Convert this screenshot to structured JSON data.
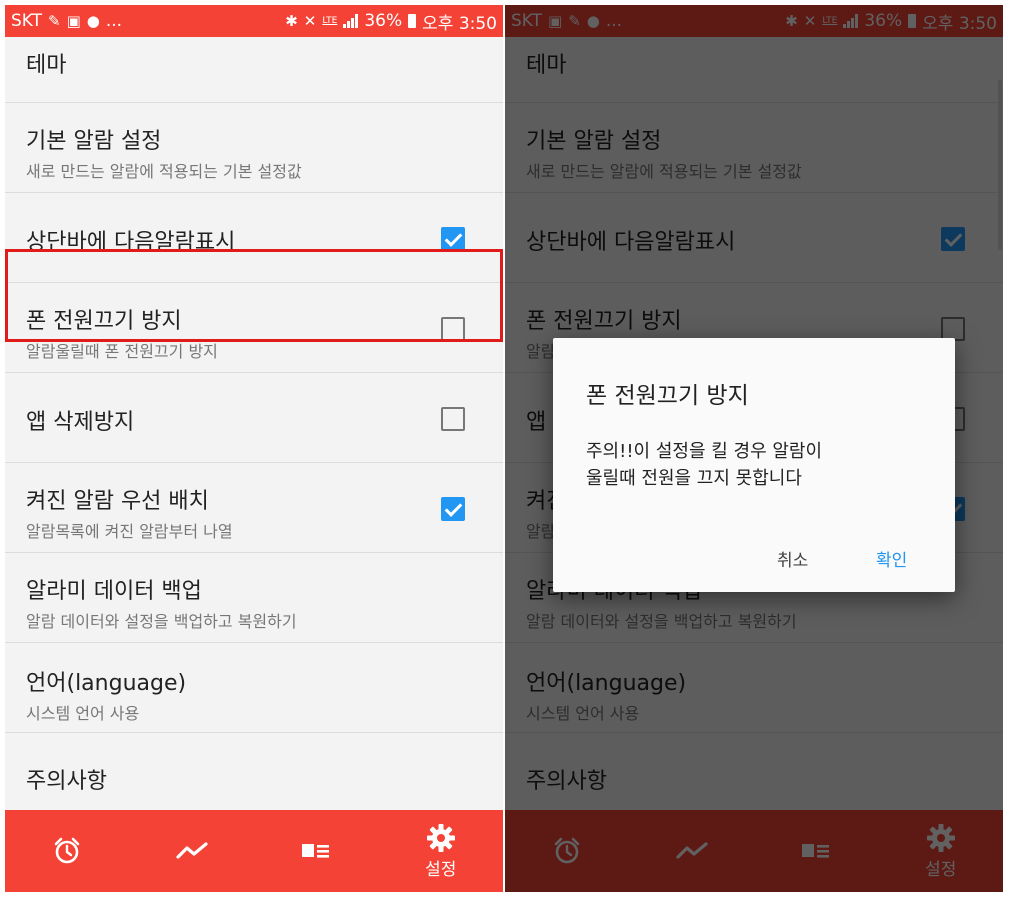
{
  "status_bar": {
    "carrier": "SKT",
    "dots": "...",
    "lte": "LTE",
    "battery": "36%",
    "time": "오후 3:50"
  },
  "settings": {
    "rows": [
      {
        "title": "테마",
        "subtitle": ""
      },
      {
        "title": "기본 알람 설정",
        "subtitle": "새로 만드는 알람에 적용되는 기본 설정값"
      },
      {
        "title": "상단바에 다음알람표시",
        "subtitle": "",
        "checked": true
      },
      {
        "title": "폰 전원끄기 방지",
        "subtitle": "알람울릴때 폰 전원끄기 방지",
        "checked": false
      },
      {
        "title": "앱 삭제방지",
        "subtitle": "",
        "checked": false
      },
      {
        "title": "켜진 알람 우선 배치",
        "subtitle": "알람목록에 켜진 알람부터 나열",
        "checked": true
      },
      {
        "title": "알라미 데이터 백업",
        "subtitle": "알람 데이터와 설정을 백업하고 복원하기"
      },
      {
        "title": "언어(language)",
        "subtitle": "시스템 언어 사용"
      },
      {
        "title": "주의사항",
        "subtitle": ""
      }
    ]
  },
  "bottom_nav": {
    "items": [
      {
        "icon": "alarm-clock-icon",
        "label": ""
      },
      {
        "icon": "trend-chart-icon",
        "label": ""
      },
      {
        "icon": "list-card-icon",
        "label": ""
      },
      {
        "icon": "gear-icon",
        "label": "설정"
      }
    ]
  },
  "dialog": {
    "title": "폰 전원끄기 방지",
    "message": "주의!!이 설정을 킬 경우 알람이\n울릴때 전원을 끄지 못합니다",
    "cancel_label": "취소",
    "ok_label": "확인"
  },
  "colors": {
    "accent": "#f44336",
    "checkbox_on": "#2196f3",
    "highlight": "#e11a1a",
    "dialog_button": "#2196f3"
  }
}
